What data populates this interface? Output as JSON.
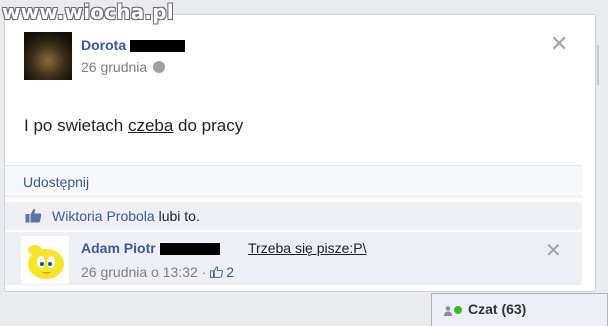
{
  "watermark": "www.wiocha.pl",
  "post": {
    "author": "Dorota",
    "date": "26 grudnia",
    "text_before": "I po swietach ",
    "text_underlined": "czeba",
    "text_after": " do pracy",
    "close_glyph": "✕"
  },
  "actions": {
    "share": "Udostępnij"
  },
  "likes": {
    "name": "Wiktoria Probola",
    "suffix": " lubi to."
  },
  "comment": {
    "author": "Adam Piotr",
    "text": "Trzeba się pisze:P\\",
    "timestamp": "26 grudnia o 13:32 · ",
    "like_count": "2",
    "close_glyph": "✕"
  },
  "chat": {
    "label": "Czat (63)"
  },
  "icons": {
    "globe": "globe-icon",
    "thumb": "thumbs-up-icon",
    "close": "close-icon",
    "online": "online-dot-icon"
  },
  "colors": {
    "link": "#3b5998",
    "background": "#e9ebee",
    "online": "#42b72a"
  }
}
